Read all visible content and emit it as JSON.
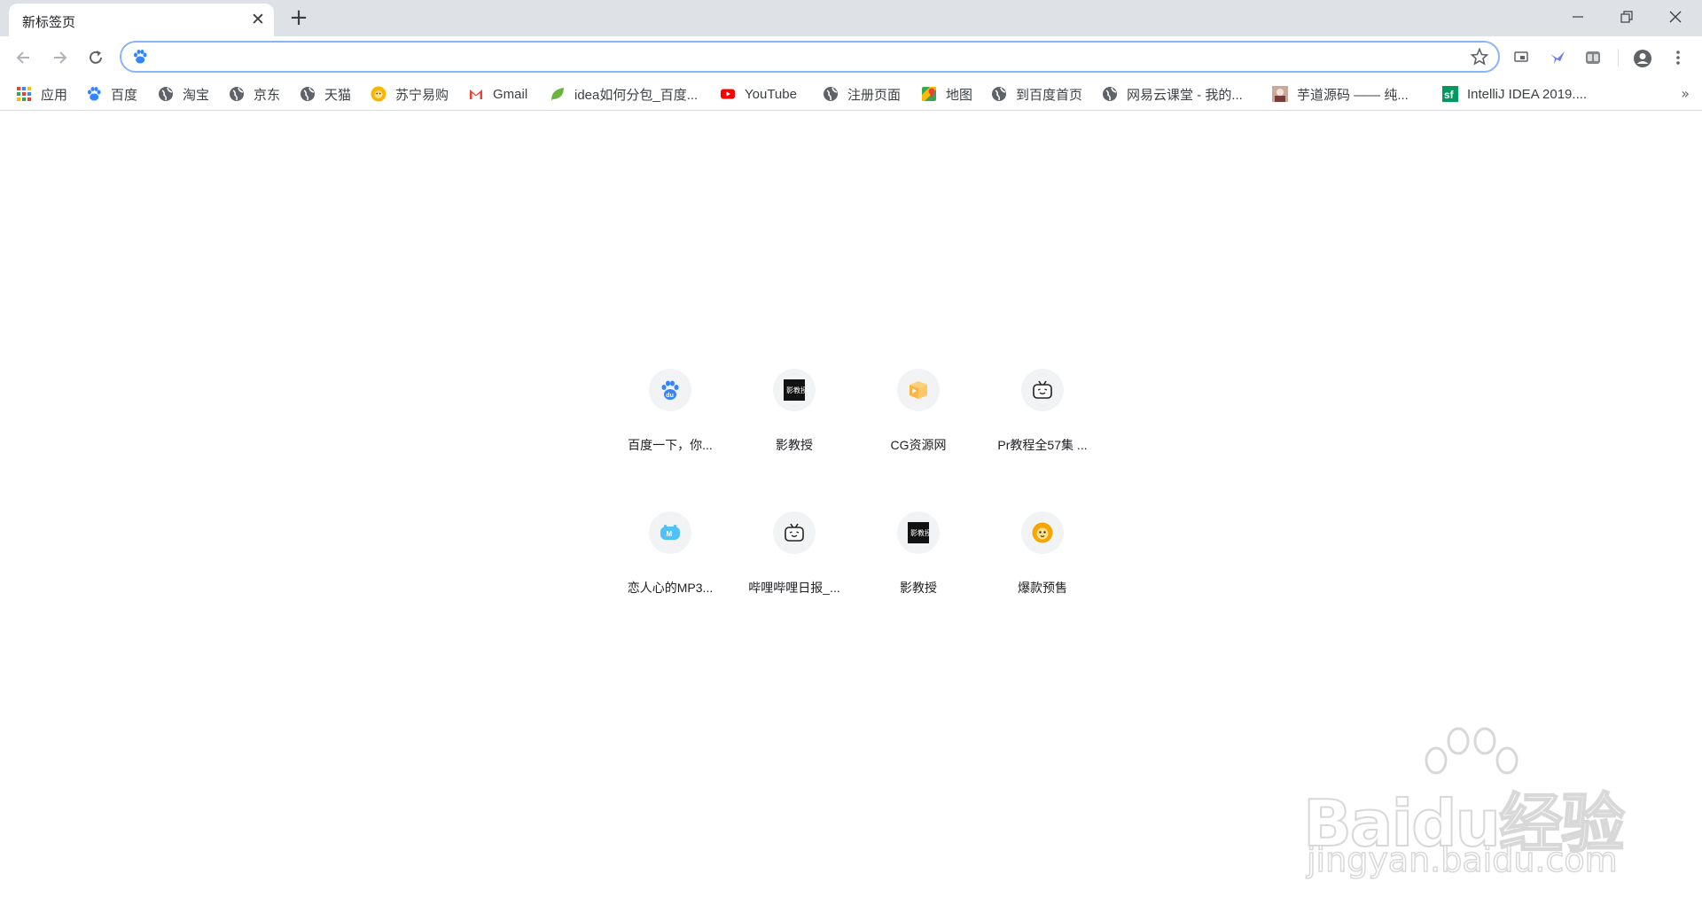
{
  "tab": {
    "title": "新标签页",
    "close_symbol": "✕"
  },
  "new_tab_symbol": "+",
  "omnibox": {
    "value": "",
    "placeholder": ""
  },
  "bookmarks": [
    {
      "label": "应用",
      "icon": "apps-grid-icon"
    },
    {
      "label": "百度",
      "icon": "baidu-paw-icon"
    },
    {
      "label": "淘宝",
      "icon": "globe-icon"
    },
    {
      "label": "京东",
      "icon": "globe-icon"
    },
    {
      "label": "天猫",
      "icon": "globe-icon"
    },
    {
      "label": "苏宁易购",
      "icon": "suning-lion-icon"
    },
    {
      "label": "Gmail",
      "icon": "gmail-icon"
    },
    {
      "label": "idea如何分包_百度...",
      "icon": "leaf-icon"
    },
    {
      "label": "YouTube",
      "icon": "youtube-icon"
    },
    {
      "label": "注册页面",
      "icon": "globe-icon"
    },
    {
      "label": "地图",
      "icon": "maps-icon"
    },
    {
      "label": "到百度首页",
      "icon": "globe-icon"
    },
    {
      "label": "网易云课堂 - 我的...",
      "icon": "globe-icon"
    },
    {
      "label": "芋道源码 —— 纯...",
      "icon": "avatar-icon"
    },
    {
      "label": "IntelliJ IDEA 2019....",
      "icon": "sf-icon"
    }
  ],
  "bookmarks_more": "»",
  "tiles": [
    {
      "label": "百度一下，你...",
      "icon": "baidu-du-icon"
    },
    {
      "label": "影教授",
      "icon": "yingjiaoshou-icon"
    },
    {
      "label": "CG资源网",
      "icon": "cg-icon"
    },
    {
      "label": "Pr教程全57集 ...",
      "icon": "bilibili-tv-icon"
    },
    {
      "label": "恋人心的MP3...",
      "icon": "m-cloud-icon"
    },
    {
      "label": "哔哩哔哩日报_...",
      "icon": "bilibili-tv-icon"
    },
    {
      "label": "影教授",
      "icon": "yingjiaoshou-icon"
    },
    {
      "label": "爆款预售",
      "icon": "suning-lion-icon"
    }
  ],
  "watermark": {
    "main": "Baidu经验",
    "sub": "jingyan.baidu.com"
  },
  "colors": {
    "tabstrip": "#dee1e6",
    "omnibox_focus": "#8ab4f8",
    "baidu_blue": "#3385ff"
  }
}
